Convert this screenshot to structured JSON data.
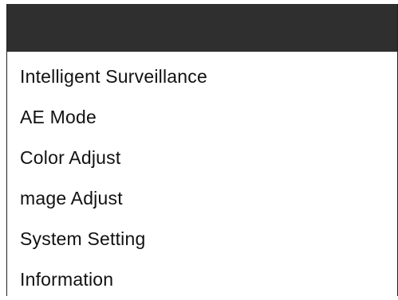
{
  "menu": {
    "items": [
      {
        "label": "Intelligent Surveillance"
      },
      {
        "label": "AE Mode"
      },
      {
        "label": "Color Adjust"
      },
      {
        "label": "mage Adjust"
      },
      {
        "label": "System Setting"
      },
      {
        "label": "Information"
      }
    ]
  },
  "colors": {
    "header_bar": "#2f2f2f",
    "background": "#ffffff",
    "text": "#111111"
  }
}
